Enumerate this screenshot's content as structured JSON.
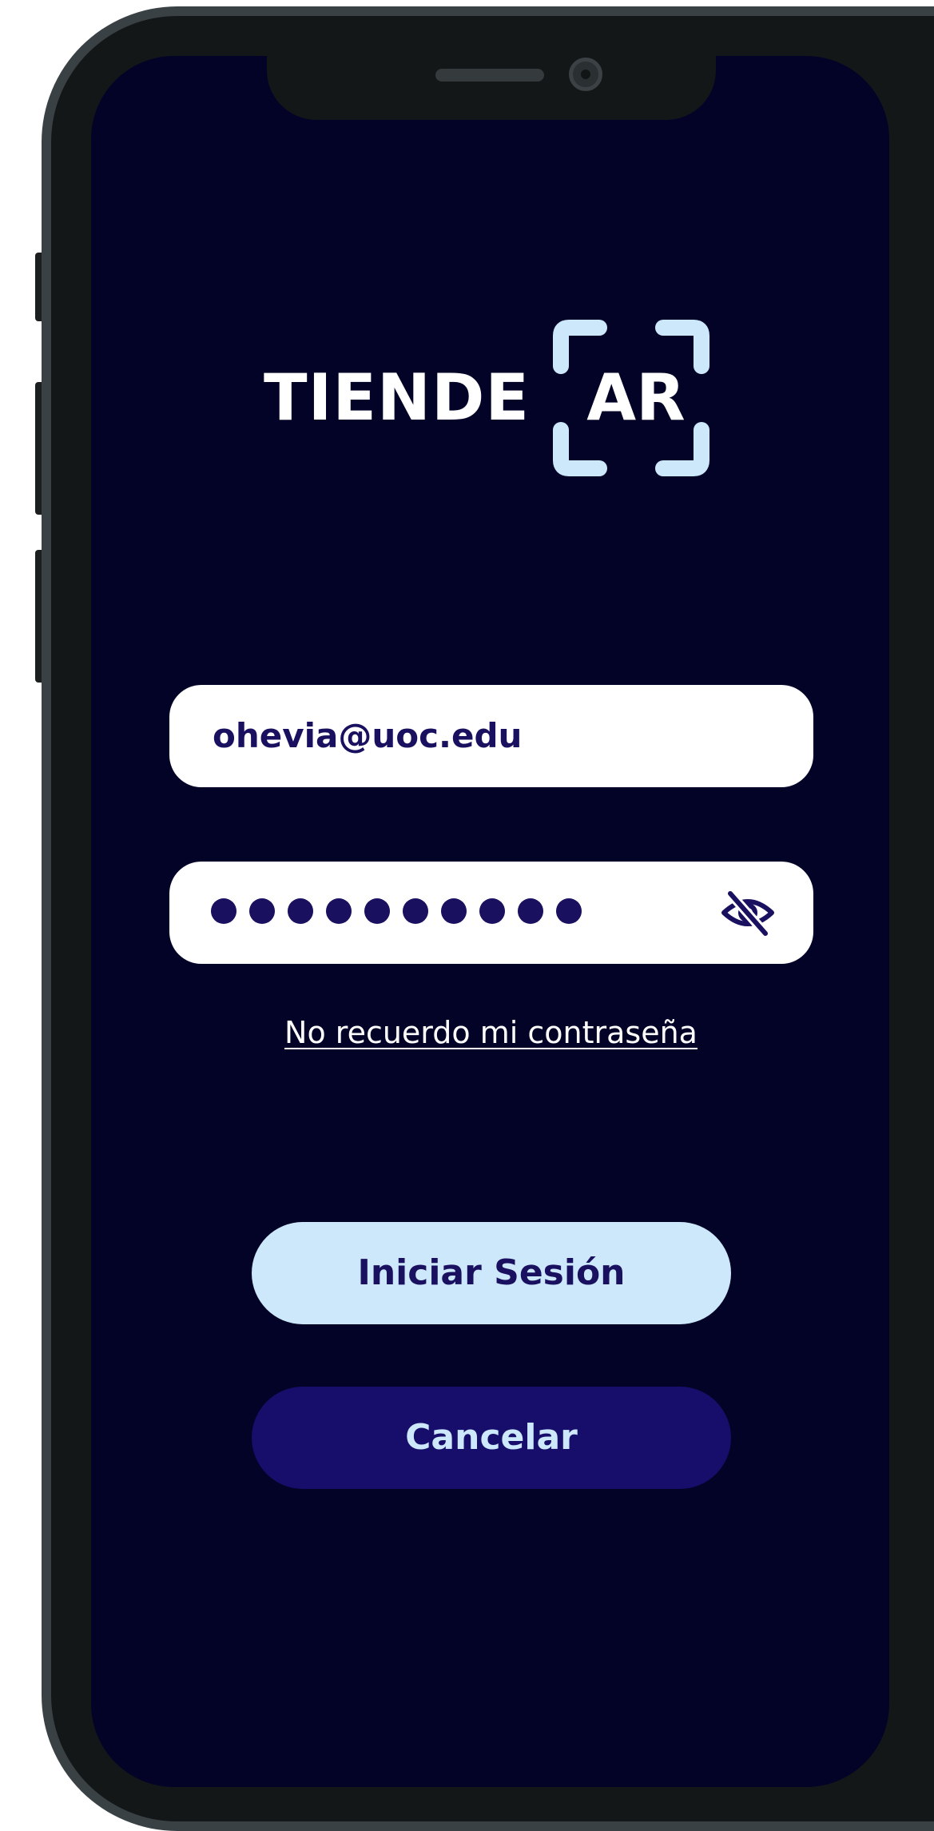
{
  "logo": {
    "word": "TIENDE",
    "ar": "AR"
  },
  "login_form": {
    "email_value": "ohevia@uoc.edu",
    "password_mask_count": 10,
    "toggle_icon": "eye-slash-icon",
    "forgot_link": "No recuerdo mi contraseña"
  },
  "actions": {
    "login_label": "Iniciar Sesión",
    "cancel_label": "Cancelar"
  },
  "colors": {
    "background": "#030328",
    "accent_light": "#cde8fb",
    "accent_dark": "#170d6a",
    "text_dark": "#1a1060"
  }
}
